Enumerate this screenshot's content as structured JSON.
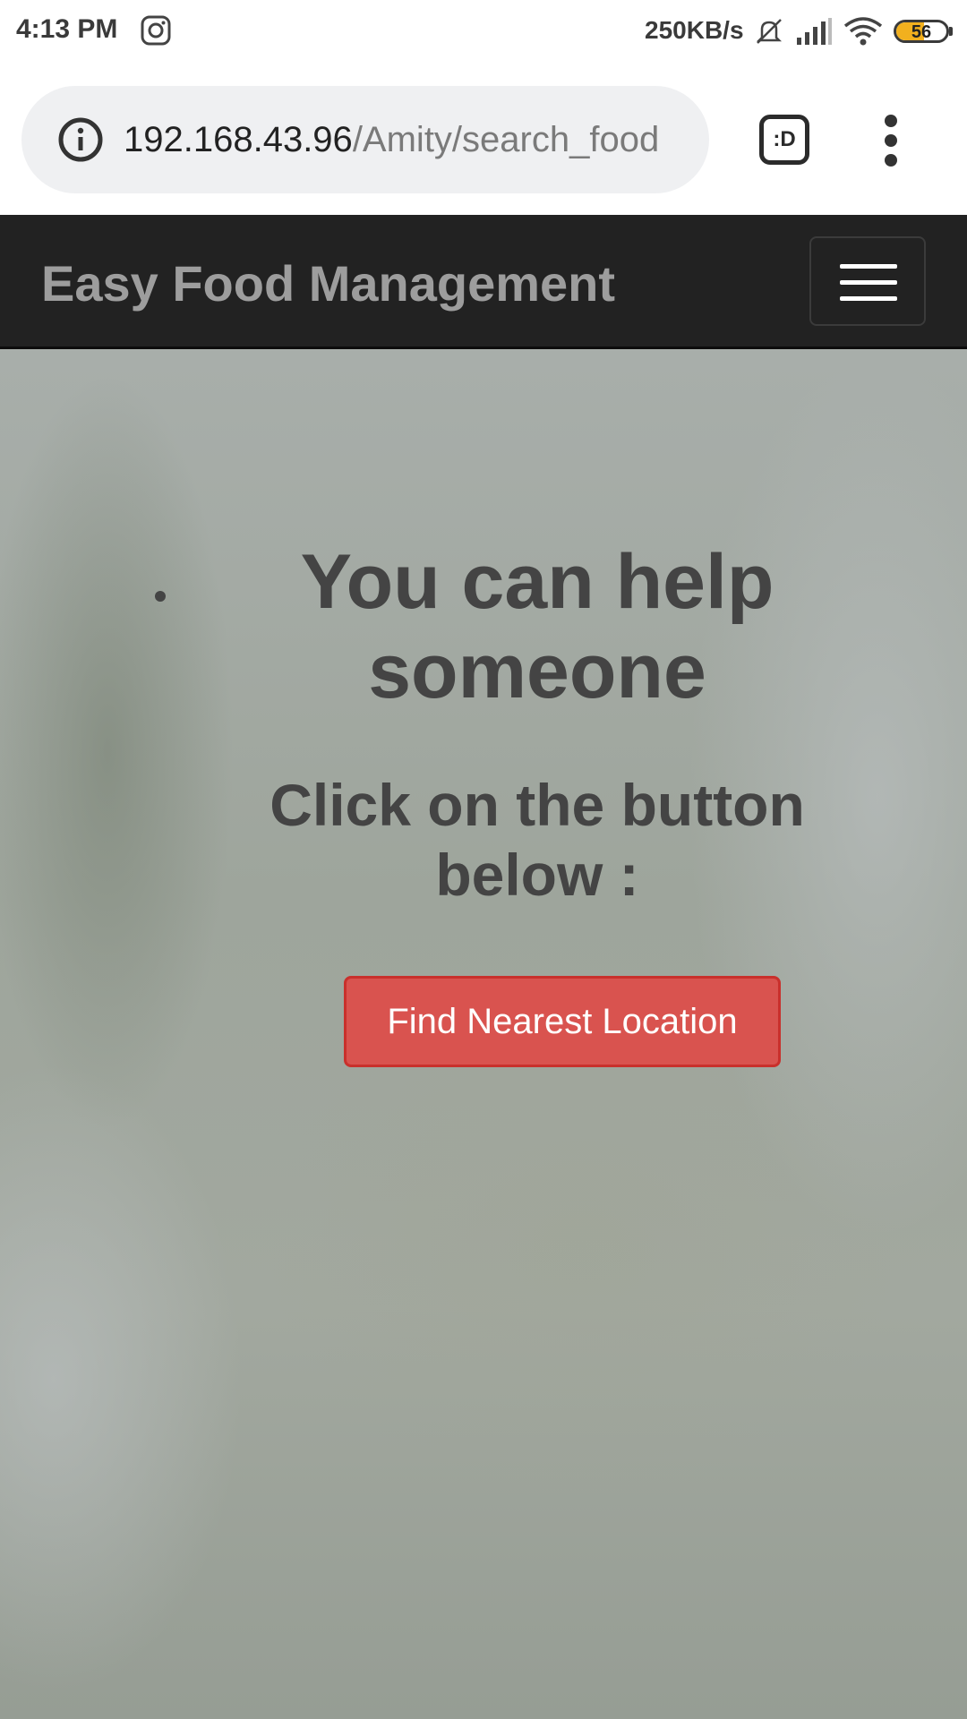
{
  "status_bar": {
    "time": "4:13 PM",
    "net_speed": "250KB/s",
    "battery_level": "56",
    "battery_fraction": 0.56,
    "icons": [
      "instagram-icon",
      "mute-icon",
      "signal-icon",
      "wifi-icon",
      "battery-icon"
    ]
  },
  "browser": {
    "url_host": "192.168.43.96",
    "url_path": "/Amity/search_food",
    "ext_label": ":D",
    "icons": [
      "info-icon",
      "more-menu-icon"
    ]
  },
  "navbar": {
    "brand": "Easy Food Management",
    "icons": [
      "hamburger-menu-icon"
    ]
  },
  "main": {
    "title": "You can help someone",
    "subtitle": "Click on the button below :",
    "cta_label": "Find Nearest Location"
  },
  "colors": {
    "navbar_bg": "#222222",
    "brand_text": "#9d9d9d",
    "cta_bg": "#d9534f",
    "heading_text": "#444444",
    "battery_fill": "#f2b01e"
  }
}
